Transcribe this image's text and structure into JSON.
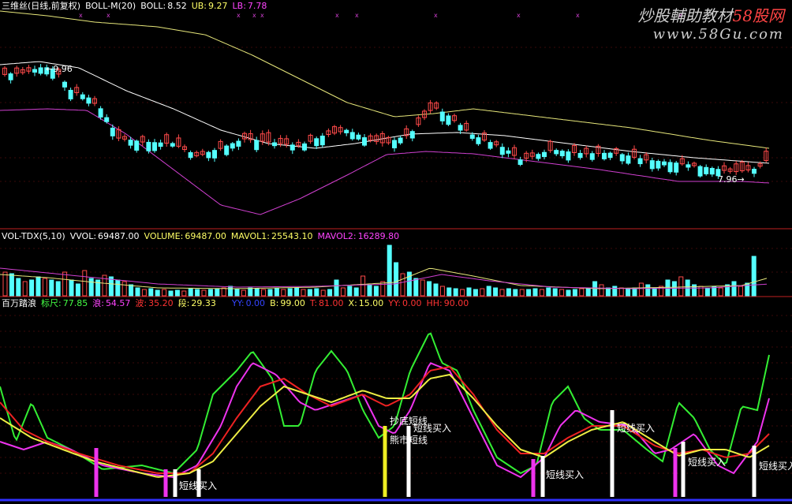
{
  "panel1": {
    "name": "三维丝(日线,前复权)",
    "ind": "BOLL-M(20)",
    "boll_label": "BOLL:",
    "boll_val": "8.52",
    "ub_label": "UB:",
    "ub_val": "9.27",
    "lb_label": "LB:",
    "lb_val": "7.78",
    "high_mark": "9.96",
    "low_mark": "7.96",
    "colors": {
      "up": "#ff4a4a",
      "down": "#54ffff",
      "mid": "#ffffff",
      "ub": "#e6e67a",
      "lb": "#d040d0"
    }
  },
  "panel2": {
    "name": "VOL-TDX(5,10)",
    "vvol_label": "VVOL:",
    "vvol_val": "69487.00",
    "volume_label": "VOLUME:",
    "volume_val": "69487.00",
    "mavol1_label": "MAVOL1:",
    "mavol1_val": "25543.10",
    "mavol2_label": "MAVOL2:",
    "mavol2_val": "16289.80"
  },
  "panel3": {
    "name": "百万踏浪",
    "biaochi_label": "标尺:",
    "biaochi_val": "77.85",
    "lang_label": "浪:",
    "lang_val": "54.57",
    "bo_label": "波:",
    "bo_val": "35.20",
    "duan_label": "段:",
    "duan_val": "29.33",
    "yy_label": "YY:",
    "yy_val": "0.00",
    "b_label": "B:",
    "b_val": "99.00",
    "t_label": "T:",
    "t_val": "81.00",
    "x_label": "X:",
    "x_val": "15.00",
    "yy2_label": "YY:",
    "yy2_val": "0.00",
    "hh_label": "HH:",
    "hh_val": "90.00",
    "signals": {
      "buy": "短线买入",
      "top": "熊市短线",
      "bottom": "抄底短线"
    }
  },
  "watermark": {
    "line1_prefix": "炒股輔助教材",
    "line1_brand": "58股网",
    "line2": "www.58Gu.com"
  },
  "chart_data": [
    {
      "type": "candlestick",
      "title": "三维丝(日线,前复权) BOLL-M(20)",
      "series": [
        {
          "name": "UB",
          "values": [
            9.27
          ]
        },
        {
          "name": "BOLL",
          "values": [
            8.52
          ]
        },
        {
          "name": "LB",
          "values": [
            7.78
          ]
        }
      ],
      "annotations": [
        "9.96",
        "7.96"
      ]
    },
    {
      "type": "bar",
      "title": "VOL-TDX(5,10)",
      "series": [
        {
          "name": "VOLUME",
          "values": [
            69487.0
          ]
        },
        {
          "name": "MAVOL1",
          "values": [
            25543.1
          ]
        },
        {
          "name": "MAVOL2",
          "values": [
            16289.8
          ]
        }
      ]
    },
    {
      "type": "line",
      "title": "百万踏浪",
      "series": [
        {
          "name": "标尺",
          "values": [
            77.85
          ]
        },
        {
          "name": "浪",
          "values": [
            54.57
          ]
        },
        {
          "name": "波",
          "values": [
            35.2
          ]
        },
        {
          "name": "段",
          "values": [
            29.33
          ]
        }
      ]
    }
  ]
}
